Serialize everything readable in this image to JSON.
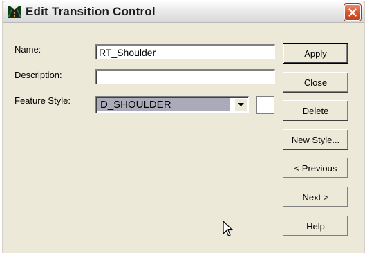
{
  "window": {
    "title": "Edit Transition Control"
  },
  "form": {
    "name_label": "Name:",
    "name_value": "RT_Shoulder",
    "description_label": "Description:",
    "description_value": "",
    "feature_style_label": "Feature Style:",
    "feature_style_value": "D_SHOULDER"
  },
  "buttons": {
    "apply": "Apply",
    "close": "Close",
    "delete": "Delete",
    "new_style": "New Style...",
    "previous": "< Previous",
    "next": "Next >",
    "help": "Help"
  },
  "colors": {
    "dialog_bg": "#ece9d8",
    "selection_bg": "#aaaab8",
    "close_button": "#d4532c"
  },
  "icons": {
    "app": "road-icon",
    "close": "close-icon",
    "dropdown": "chevron-down-icon",
    "cursor": "mouse-pointer-icon"
  }
}
